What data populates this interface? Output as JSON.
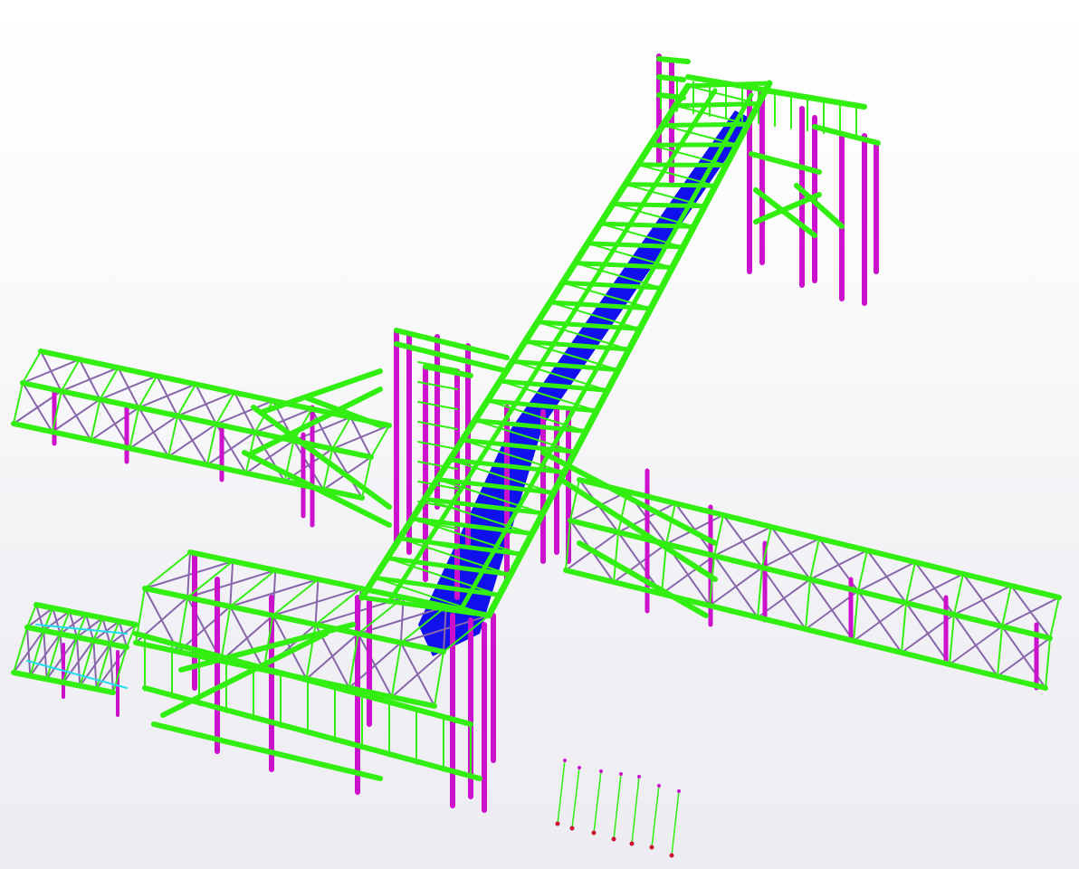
{
  "colors": {
    "background_top": "#ffffff",
    "background_bottom": "#ececf2",
    "beam": "#33ee11",
    "beam_dark": "#22c40c",
    "column": "#cc11cc",
    "bracing": "#8866aa",
    "conveyor_belt": "#1111ee",
    "anchor": "#cc1133",
    "highlight_line": "#22ddee"
  },
  "viewport": {
    "projection": "isometric-3d",
    "render_mode": "solid-members"
  },
  "model": {
    "type": "steel-structure",
    "components": [
      {
        "id": "inclined-conveyor-gallery",
        "has_belt": true
      },
      {
        "id": "upper-transfer-tower"
      },
      {
        "id": "west-bridge-truss"
      },
      {
        "id": "east-bridge-truss"
      },
      {
        "id": "lower-support-frame"
      },
      {
        "id": "southwest-platform"
      },
      {
        "id": "central-junction-tower"
      },
      {
        "id": "anchor-bolt-group",
        "count": 7
      }
    ]
  }
}
